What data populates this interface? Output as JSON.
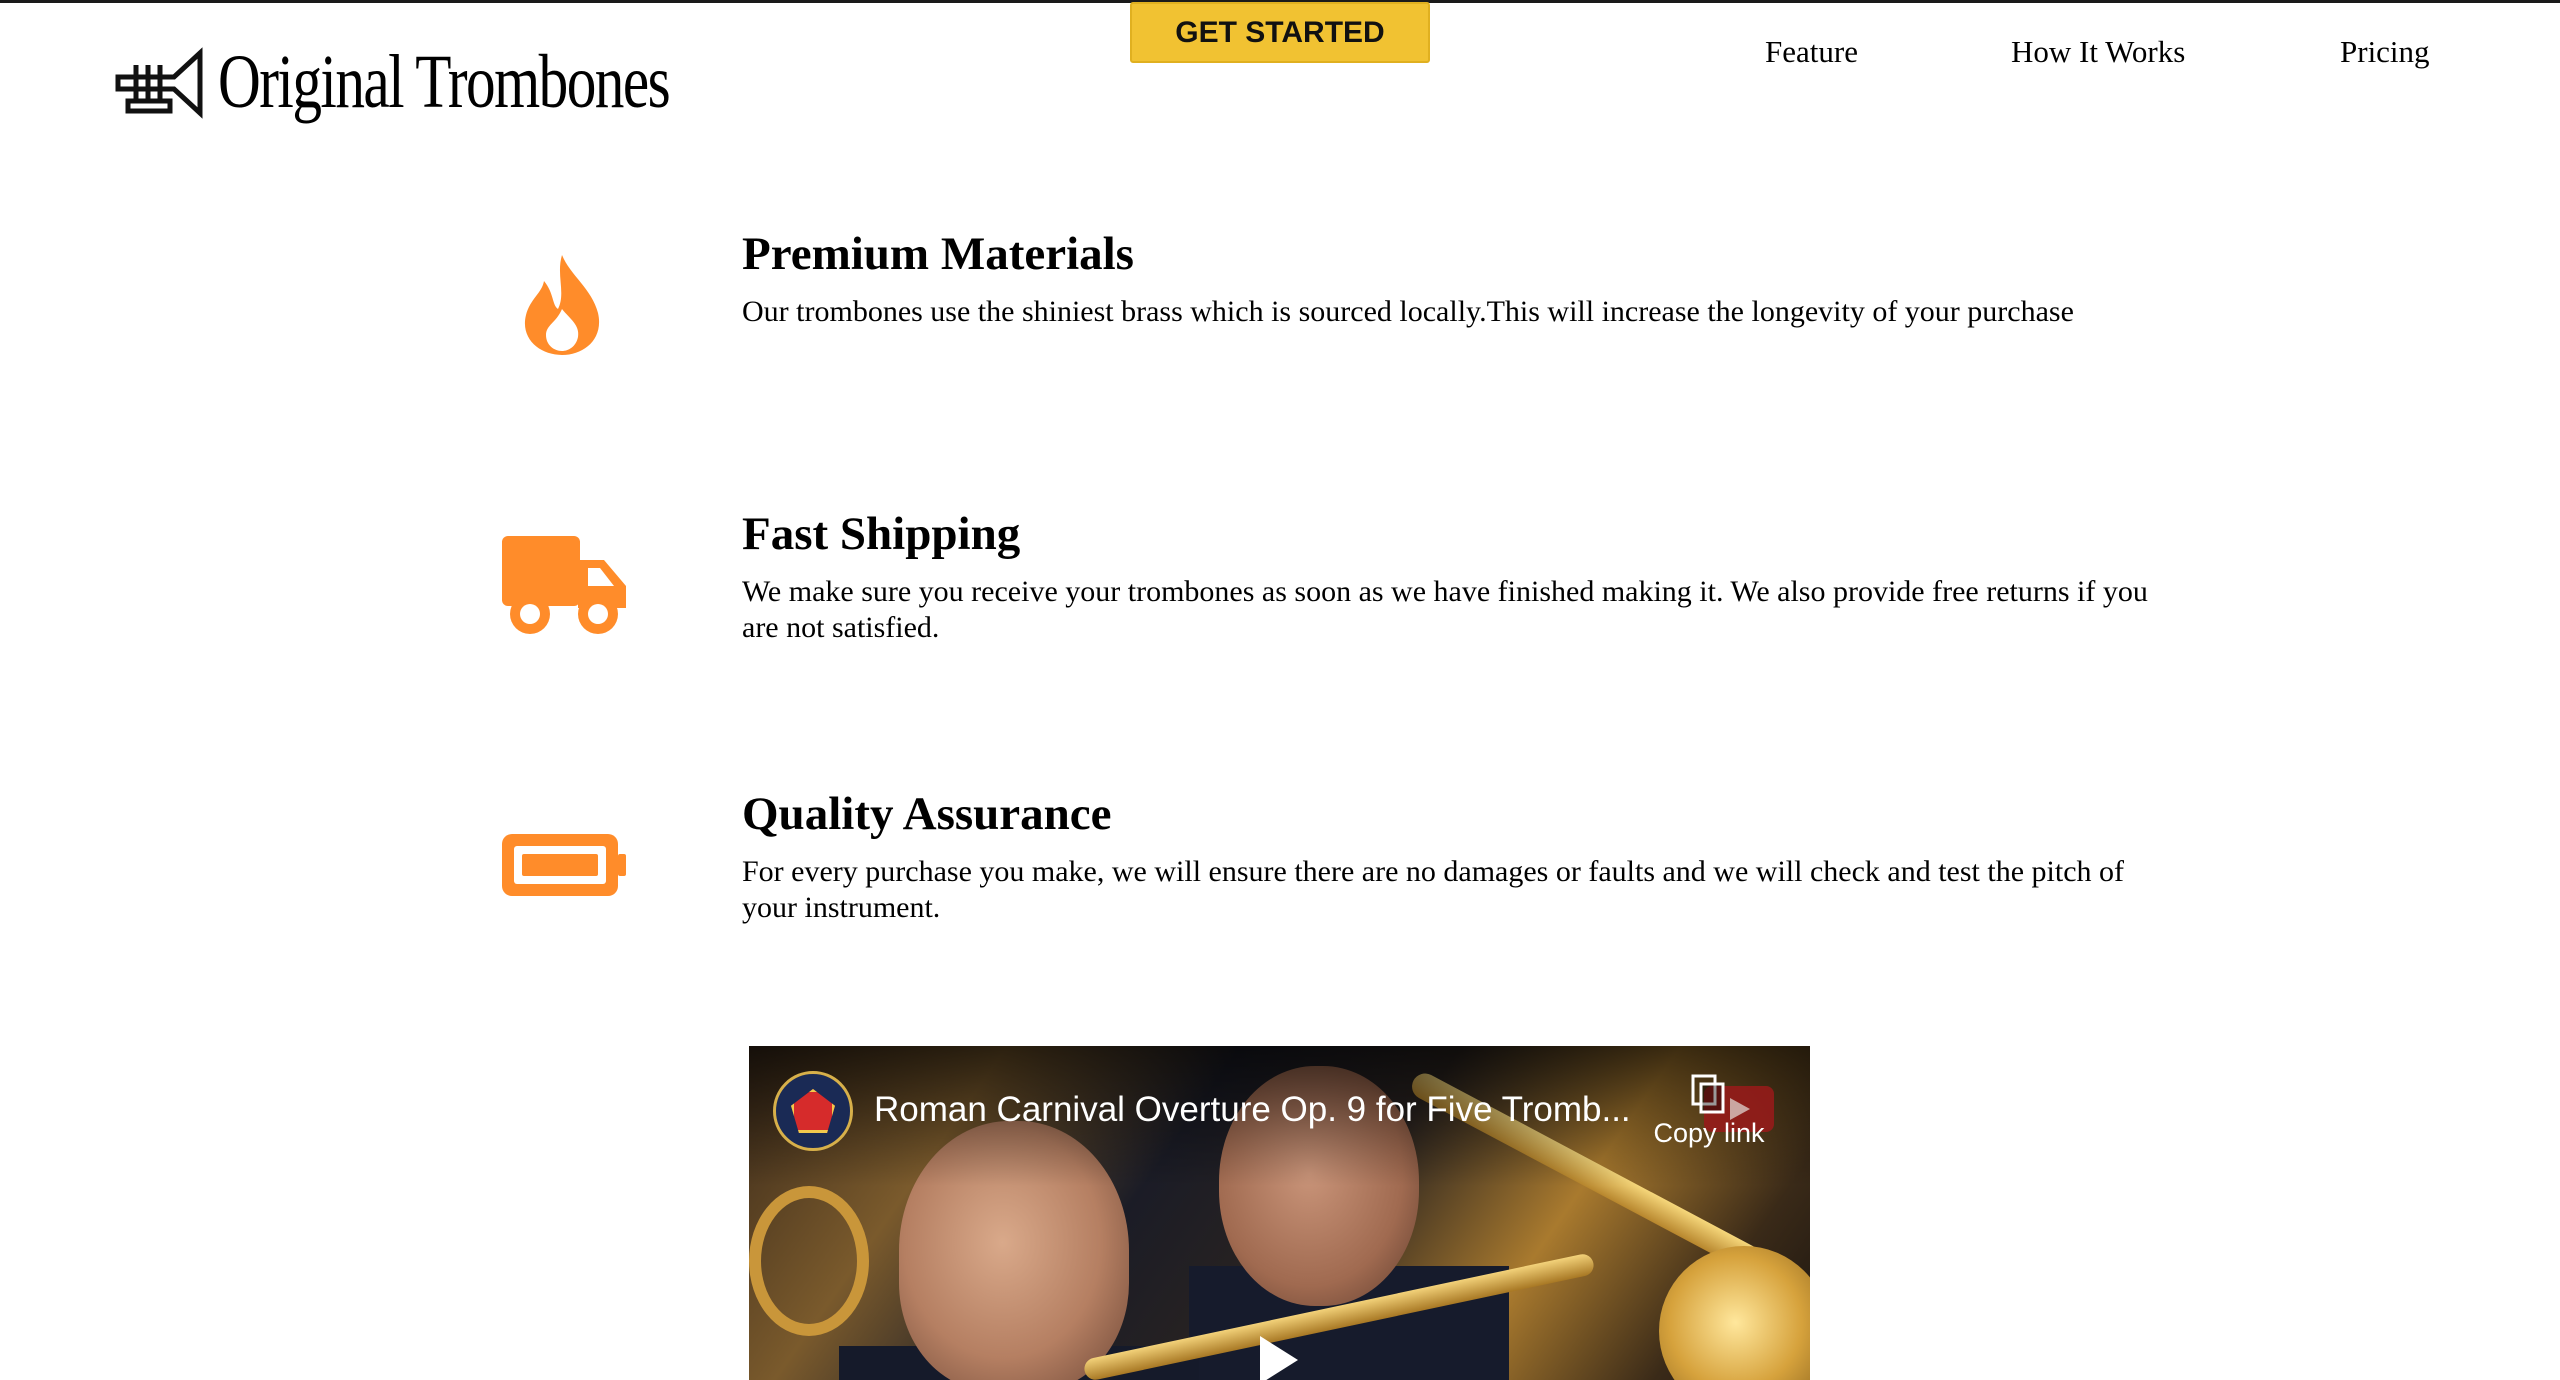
{
  "header": {
    "logo_text": "Original Trombones",
    "logo_icon": "trumpet-icon",
    "cta_label": "GET STARTED",
    "nav": [
      {
        "label": "Feature"
      },
      {
        "label": "How It Works"
      },
      {
        "label": "Pricing"
      }
    ]
  },
  "colors": {
    "accent": "#FF8C2A",
    "cta": "#F1C232",
    "text": "#000000"
  },
  "features": [
    {
      "icon": "flame-icon",
      "title": "Premium Materials",
      "description": "Our trombones use the shiniest brass which is sourced locally.This will increase the longevity of your purchase"
    },
    {
      "icon": "truck-icon",
      "title": "Fast Shipping",
      "description": "We make sure you receive your trombones as soon as we have finished making it. We also provide free returns if you are not satisfied."
    },
    {
      "icon": "battery-icon",
      "title": "Quality Assurance",
      "description": "For every purchase you make, we will ensure there are no damages or faults and we will check and test the pitch of your instrument."
    }
  ],
  "video": {
    "title": "Roman Carnival Overture Op. 9 for Five Tromb...",
    "copy_link_label": "Copy link"
  }
}
